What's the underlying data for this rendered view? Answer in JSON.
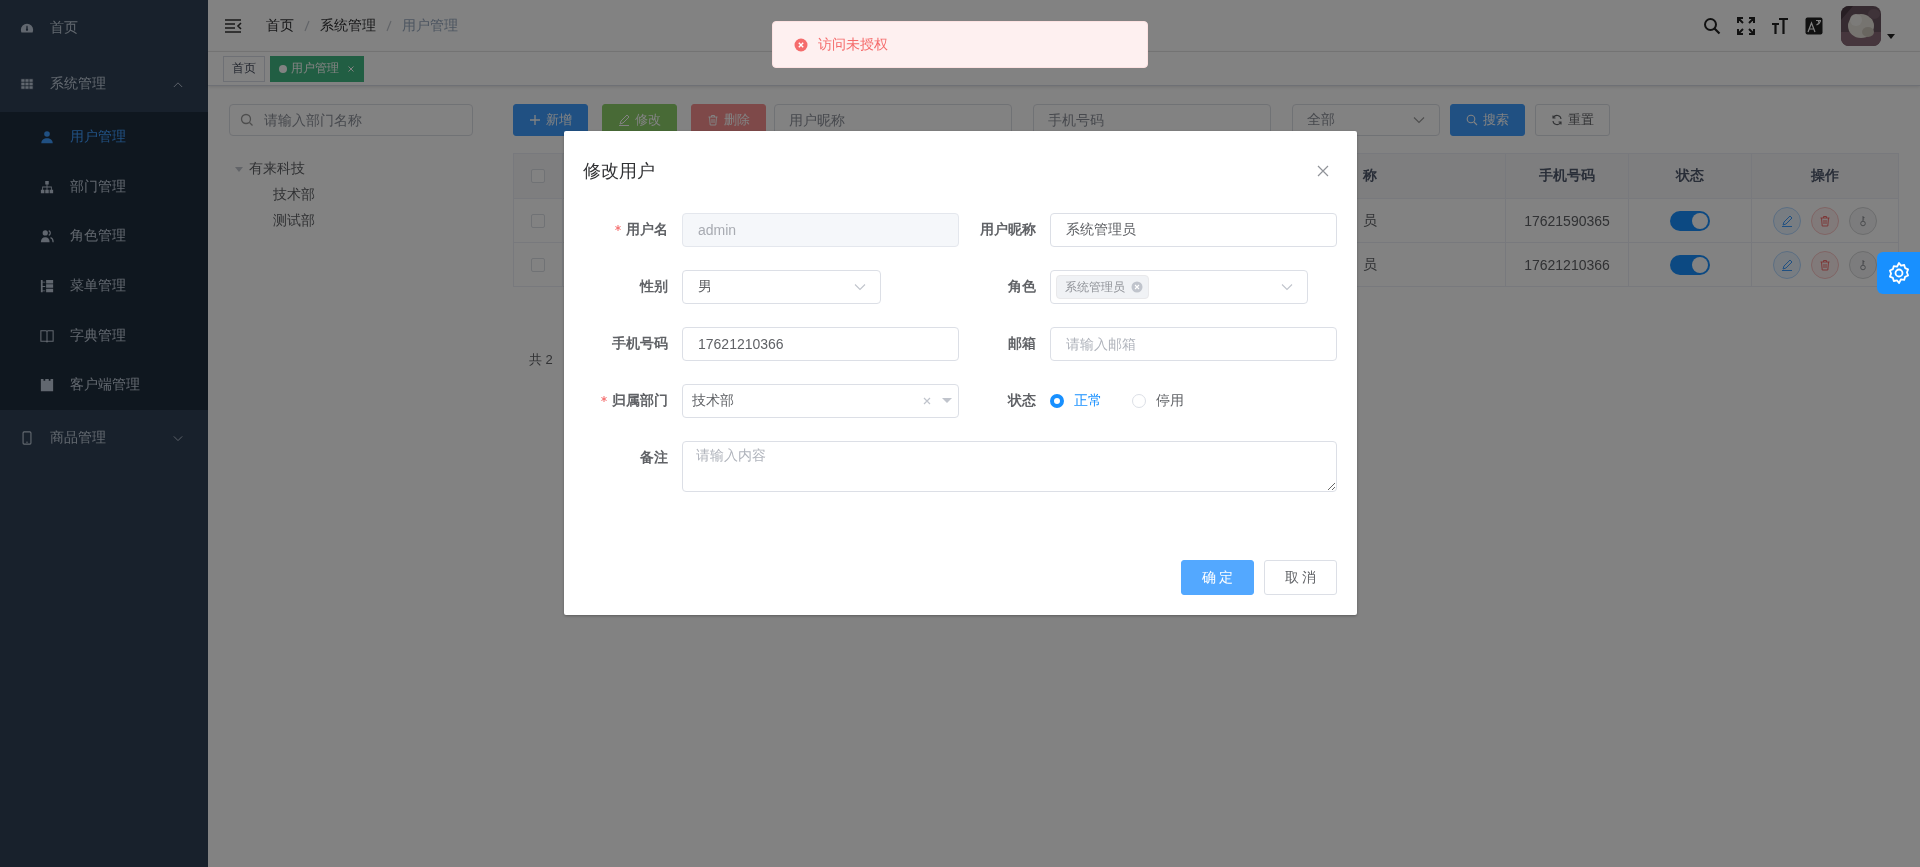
{
  "sidebar": {
    "items": [
      {
        "label": "首页",
        "kind": "gauge",
        "selected": false
      },
      {
        "label": "系统管理",
        "kind": "grid",
        "expanded": true,
        "children": [
          {
            "label": "用户管理",
            "kind": "user",
            "selected": true
          },
          {
            "label": "部门管理",
            "kind": "org",
            "selected": false
          },
          {
            "label": "角色管理",
            "kind": "users",
            "selected": false
          },
          {
            "label": "菜单管理",
            "kind": "list",
            "selected": false
          },
          {
            "label": "字典管理",
            "kind": "book",
            "selected": false
          },
          {
            "label": "客户端管理",
            "kind": "card",
            "selected": false
          }
        ]
      },
      {
        "label": "商品管理",
        "kind": "phone",
        "expanded": false
      }
    ]
  },
  "breadcrumb": [
    "首页",
    "系统管理",
    "用户管理"
  ],
  "tags": [
    {
      "label": "首页",
      "selected": false,
      "closable": false
    },
    {
      "label": "用户管理",
      "selected": true,
      "closable": true
    }
  ],
  "toast": {
    "kind": "error",
    "message": "访问未授权"
  },
  "dept_tree": {
    "placeholder": "请输入部门名称",
    "nodes": [
      {
        "label": "有来科技",
        "expanded": true,
        "children": [
          {
            "label": "技术部"
          },
          {
            "label": "测试部"
          }
        ]
      }
    ]
  },
  "toolbar": {
    "buttons": [
      {
        "label": "新增",
        "kind": "primary",
        "disabled": false
      },
      {
        "label": "修改",
        "kind": "success",
        "disabled": true
      },
      {
        "label": "删除",
        "kind": "danger",
        "disabled": true
      }
    ],
    "filters": [
      {
        "kind": "input",
        "placeholder": "用户昵称"
      },
      {
        "kind": "input",
        "placeholder": "手机号码"
      },
      {
        "kind": "select",
        "placeholder": "全部"
      }
    ],
    "search": "搜索",
    "reset": "重置"
  },
  "table": {
    "select_all": false,
    "columns": [
      "称",
      "手机号码",
      "状态",
      "操作"
    ],
    "rows": [
      {
        "checked": false,
        "column_2": "员",
        "phone": "17621590365",
        "enabled": true
      },
      {
        "checked": false,
        "column_2": "员",
        "phone": "17621210366",
        "enabled": true
      }
    ]
  },
  "pagination": {
    "total": "共 2"
  },
  "dialog": {
    "title": "修改用户",
    "fields": [
      {
        "label": "用户名",
        "kind": "input",
        "required": true,
        "disabled": true,
        "value": "admin"
      },
      {
        "label": "用户昵称",
        "kind": "input",
        "required": false,
        "value": "系统管理员"
      },
      {
        "label": "性别",
        "kind": "select",
        "required": false,
        "value": "男"
      },
      {
        "label": "角色",
        "kind": "multiselect",
        "required": false,
        "tags": [
          "系统管理员"
        ]
      },
      {
        "label": "手机号码",
        "kind": "input",
        "required": false,
        "value": "17621210366"
      },
      {
        "label": "邮箱",
        "kind": "input",
        "required": false,
        "placeholder": "请输入邮箱"
      },
      {
        "label": "归属部门",
        "kind": "treeselect",
        "required": true,
        "value": "技术部"
      },
      {
        "label": "状态",
        "kind": "radio",
        "required": false,
        "options": [
          {
            "label": "正常",
            "selected": true
          },
          {
            "label": "停用",
            "selected": false
          }
        ]
      },
      {
        "label": "备注",
        "kind": "textarea",
        "required": false,
        "placeholder": "请输入内容"
      }
    ],
    "buttons": [
      {
        "label": "确 定",
        "kind": "primary"
      },
      {
        "label": "取 消",
        "kind": "default"
      }
    ]
  }
}
